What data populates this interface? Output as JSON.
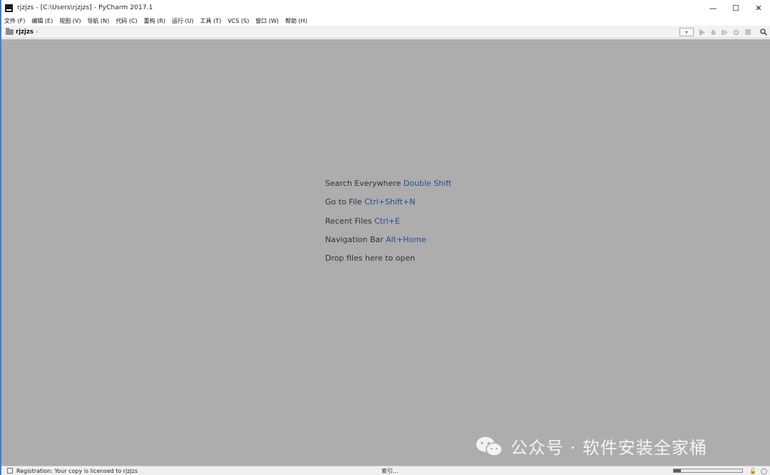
{
  "window": {
    "title": "rjzjzs - [C:\\Users\\rjzjzs] - PyCharm 2017.1",
    "controls": {
      "minimize": "—",
      "maximize": "☐",
      "close": "✕"
    }
  },
  "menu": {
    "items": [
      "文件 (F)",
      "编辑 (E)",
      "视图 (V)",
      "导航 (N)",
      "代码 (C)",
      "重构 (R)",
      "运行 (U)",
      "工具 (T)",
      "VCS (S)",
      "窗口 (W)",
      "帮助 (H)"
    ]
  },
  "navbar": {
    "breadcrumb": "rjzjzs",
    "separator": "›",
    "run_config_arrow": "▾",
    "toolbar_icons": [
      "run-icon",
      "debug-icon",
      "coverage-icon",
      "profile-icon",
      "stop-icon",
      "search-icon"
    ]
  },
  "editor": {
    "hints": [
      {
        "text": "Search Everywhere ",
        "shortcut": "Double Shift"
      },
      {
        "text": "Go to File ",
        "shortcut": "Ctrl+Shift+N"
      },
      {
        "text": "Recent Files ",
        "shortcut": "Ctrl+E"
      },
      {
        "text": "Navigation Bar ",
        "shortcut": "Alt+Home"
      },
      {
        "text": "Drop files here to open",
        "shortcut": ""
      }
    ],
    "watermark": "公众号 · 软件安装全家桶"
  },
  "statusbar": {
    "message": "Registration: Your copy is licensed to rjzjzs",
    "indexing": "索引...",
    "progress": 0.1,
    "colors": {
      "progress_fill": "#5a5a5a"
    }
  },
  "colors": {
    "editor_background": "#adadad",
    "shortcut_text": "#2b4a9b",
    "window_border": "#3c7fd6"
  }
}
